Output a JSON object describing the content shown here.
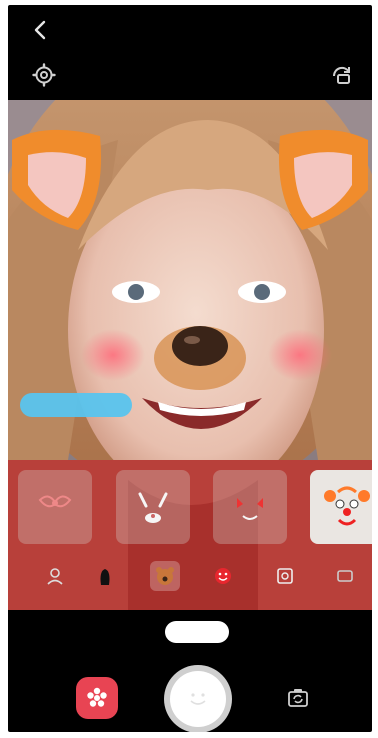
{
  "screen": {
    "icons": {
      "back": "back-chevron-icon",
      "settings": "settings-gear-icon",
      "flip": "front-rear-switch-icon",
      "ar": "ar-emoji-star-icon",
      "switch_camera": "switch-camera-icon"
    },
    "colors": {
      "background": "#000000",
      "ar_button": "#e84453",
      "toast": "#58c4ee",
      "shutter_ring": "#cfcfcf"
    }
  },
  "modes": {
    "selected_label": "",
    "other_label": ""
  },
  "filters": {
    "cards": [
      {
        "name": "bow-ears-mask"
      },
      {
        "name": "bunny-mask"
      },
      {
        "name": "devil-mask"
      },
      {
        "name": "clown-mask",
        "selected": true
      }
    ],
    "categories": [
      {
        "name": "person-category-icon"
      },
      {
        "name": "animal-category-icon",
        "active": true
      },
      {
        "name": "emoji-category-icon"
      },
      {
        "name": "frame-category-icon"
      },
      {
        "name": "more-category-icon"
      }
    ]
  }
}
